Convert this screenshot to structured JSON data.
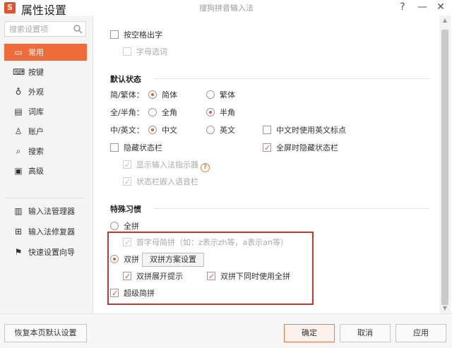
{
  "app_title": "属性设置",
  "window_caption": "搜狗拼音输入法",
  "logo_letter": "S",
  "window_controls": {
    "help": "?",
    "minimize": "—",
    "close": "✕"
  },
  "search": {
    "placeholder": "搜索设置项",
    "value": ""
  },
  "sidebar": {
    "items": [
      {
        "label": "常用",
        "icon": "monitor-icon",
        "active": true
      },
      {
        "label": "按键",
        "icon": "keyboard-icon",
        "active": false
      },
      {
        "label": "外观",
        "icon": "shirt-icon",
        "active": false
      },
      {
        "label": "词库",
        "icon": "book-icon",
        "active": false
      },
      {
        "label": "账户",
        "icon": "user-icon",
        "active": false
      },
      {
        "label": "搜索",
        "icon": "search-icon",
        "active": false
      },
      {
        "label": "高级",
        "icon": "advanced-icon",
        "active": false
      }
    ],
    "tools": [
      {
        "label": "输入法管理器",
        "icon": "manager-icon"
      },
      {
        "label": "输入法修复器",
        "icon": "repair-icon"
      },
      {
        "label": "快速设置向导",
        "icon": "flag-icon"
      }
    ]
  },
  "main": {
    "space_output": {
      "label": "按空格出字",
      "checked": false
    },
    "letter_select": {
      "label": "字母选词",
      "checked": false
    },
    "default_state": {
      "title": "默认状态",
      "simp_trad": {
        "label": "简/繁体：",
        "options": [
          "简体",
          "繁体"
        ],
        "selected": 0
      },
      "width": {
        "label": "全/半角：",
        "options": [
          "全角",
          "半角"
        ],
        "selected": 1
      },
      "lang": {
        "label": "中/英文：",
        "options": [
          "中文",
          "英文"
        ],
        "selected": 0
      },
      "cn_english_punct": {
        "label": "中文时使用英文标点",
        "checked": false
      },
      "hide_status_bar": {
        "label": "隐藏状态栏",
        "checked": false
      },
      "fullscreen_hide": {
        "label": "全屏时隐藏状态栏",
        "checked": true
      },
      "show_indicator": {
        "label": "显示输入法指示器",
        "checked": true
      },
      "embed_voice": {
        "label": "状态栏嵌入语音栏",
        "checked": true
      }
    },
    "special_habits": {
      "title": "特殊习惯",
      "full_pinyin": {
        "label": "全拼",
        "selected": false
      },
      "initial_abbrev": {
        "label": "首字母简拼（如：z表示zh等，a表示an等）",
        "checked": true
      },
      "double_pinyin": {
        "label": "双拼",
        "selected": true
      },
      "double_scheme_button": "双拼方案设置",
      "double_expand_hint": {
        "label": "双拼展开提示",
        "checked": true
      },
      "double_with_full": {
        "label": "双拼下同时使用全拼",
        "checked": true
      },
      "super_abbrev": {
        "label": "超级简拼",
        "checked": true
      }
    }
  },
  "footer": {
    "restore_default": "恢复本页默认设置",
    "ok": "确定",
    "cancel": "取消",
    "apply": "应用"
  },
  "colors": {
    "accent": "#f06b3a",
    "highlight_border": "#c8372d"
  }
}
